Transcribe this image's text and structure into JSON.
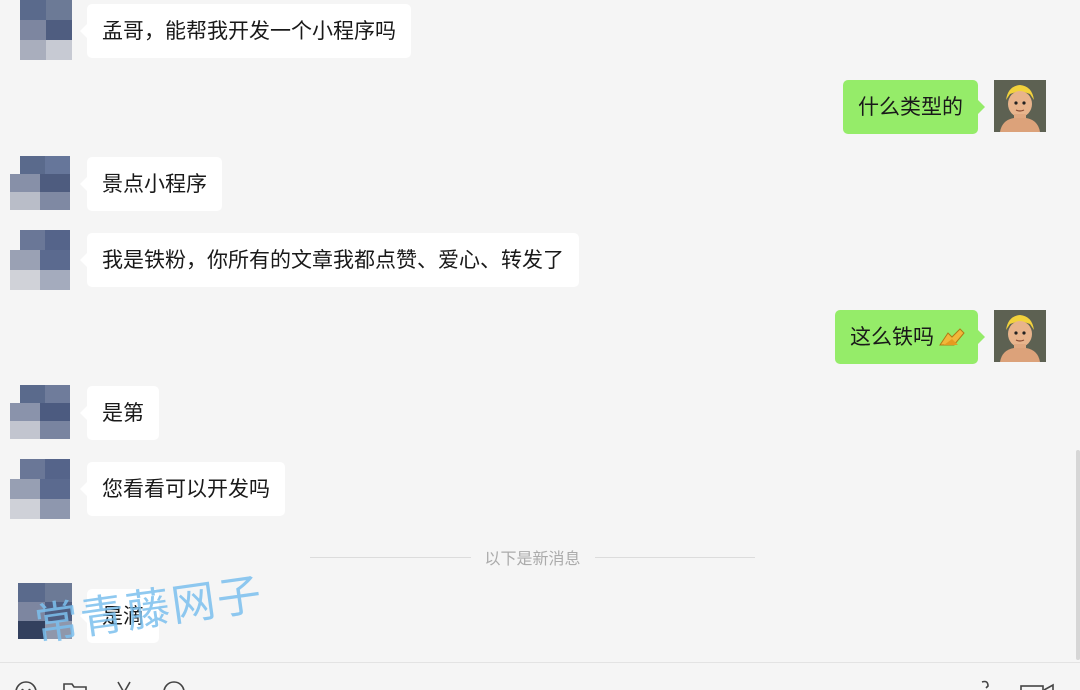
{
  "messages": [
    {
      "side": "left",
      "text": "孟哥，能帮我开发一个小程序吗"
    },
    {
      "side": "right",
      "text": "什么类型的"
    },
    {
      "side": "left",
      "text": "景点小程序"
    },
    {
      "side": "left",
      "text": "我是铁粉，你所有的文章我都点赞、爱心、转发了"
    },
    {
      "side": "right",
      "text": "这么铁吗",
      "emoji": "handshake-emoji"
    },
    {
      "side": "left",
      "text": "是第"
    },
    {
      "side": "left",
      "text": "您看看可以开发吗"
    },
    {
      "side": "left",
      "text": "是滴"
    }
  ],
  "divider": {
    "text": "以下是新消息"
  },
  "watermark": {
    "text": "常青藤网子"
  },
  "toolbar": {
    "icons": [
      "emoji-icon",
      "folder-icon",
      "scissors-icon",
      "chat-history-icon",
      "phone-icon",
      "video-call-icon"
    ]
  },
  "colors": {
    "background": "#f5f5f5",
    "bubble_in": "#ffffff",
    "bubble_out": "#95ec69",
    "watermark": "#7cc0ee"
  }
}
